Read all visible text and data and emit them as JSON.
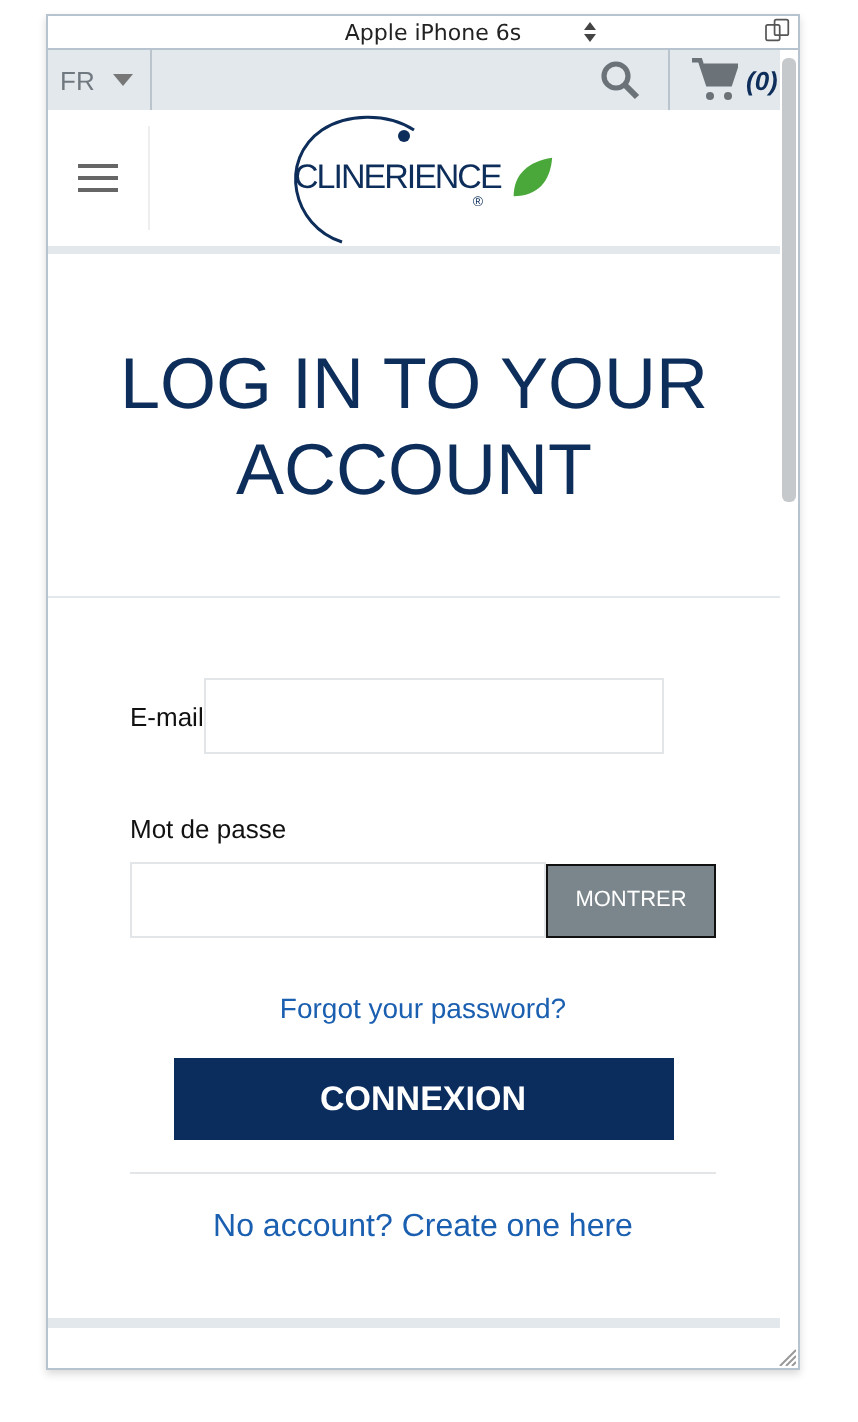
{
  "device_bar": {
    "title": "Apple iPhone 6s"
  },
  "header": {
    "language": "FR",
    "cart_count": "(0)"
  },
  "logo": {
    "text": "CLINERIENCE",
    "mark": "®"
  },
  "page_title": "LOG IN TO YOUR ACCOUNT",
  "form": {
    "email_label": "E-mail",
    "password_label": "Mot de passe",
    "show_button": "MONTRER",
    "forgot_link": "Forgot your password?",
    "submit_button": "CONNEXION",
    "signup_link": "No account? Create one here"
  }
}
